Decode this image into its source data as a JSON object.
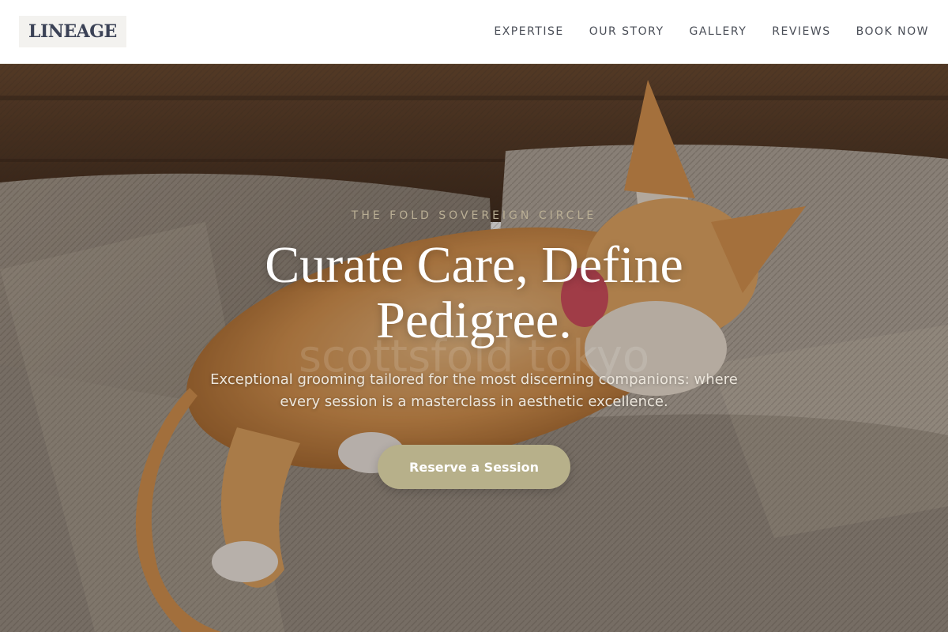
{
  "header": {
    "logo_text": "LINEAGE",
    "nav": [
      {
        "label": "EXPERTISE"
      },
      {
        "label": "OUR STORY"
      },
      {
        "label": "GALLERY"
      },
      {
        "label": "REVIEWS"
      },
      {
        "label": "BOOK NOW"
      }
    ]
  },
  "hero": {
    "eyebrow": "THE FOLD SOVEREIGN CIRCLE",
    "headline": "Curate Care, Define Pedigree.",
    "subhead": "Exceptional grooming tailored for the most discerning companions: where every session is a masterclass in aesthetic excellence.",
    "cta_label": "Reserve a Session",
    "watermark": "scottsfold tokyo",
    "image_subject": "orange-and-white cat stretching on a beige cushion"
  },
  "colors": {
    "logo_text": "#3b4256",
    "nav_text": "#4a4e57",
    "eyebrow": "#b9ae94",
    "cta_bg": "#b7b08a"
  }
}
